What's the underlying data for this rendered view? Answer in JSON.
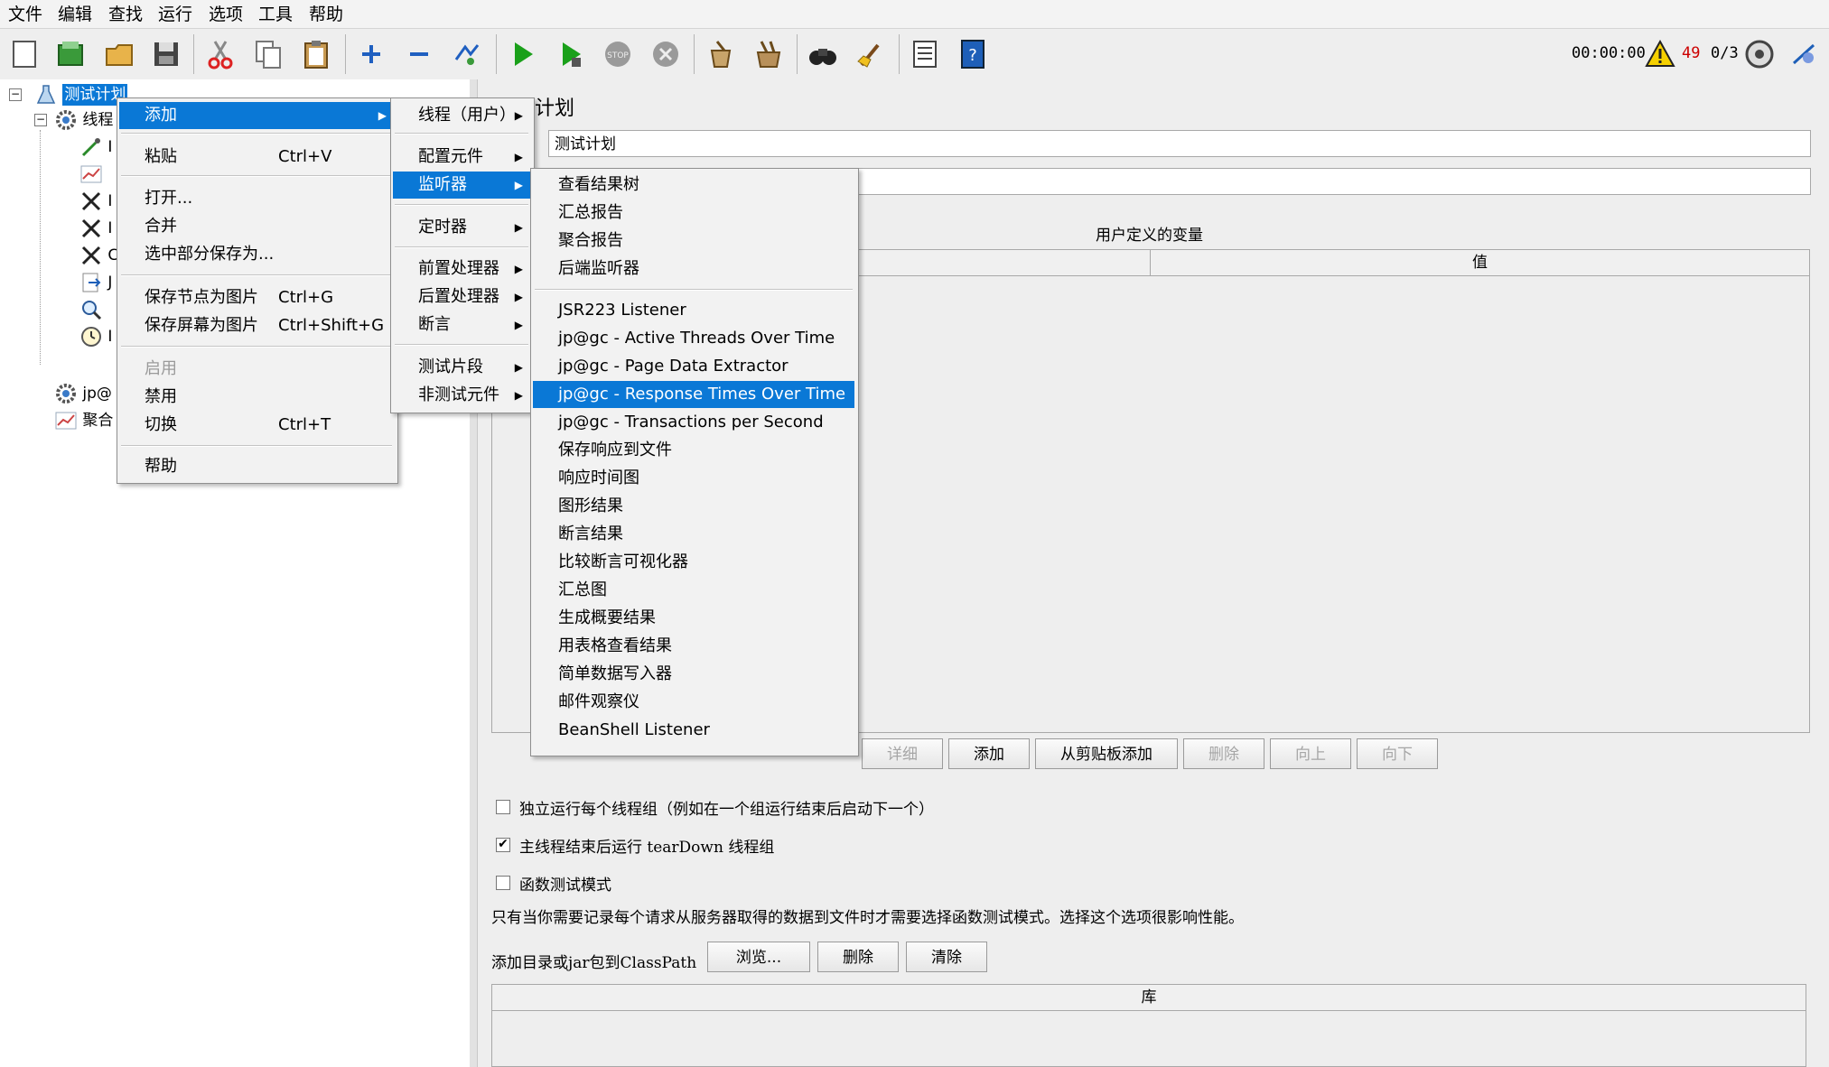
{
  "menubar": [
    "文件",
    "编辑",
    "查找",
    "运行",
    "选项",
    "工具",
    "帮助"
  ],
  "status": {
    "time": "00:00:00",
    "warning_count": "49",
    "threads": "0/3"
  },
  "colors": {
    "selection": "#0a78d6",
    "warning": "#cc0000"
  },
  "toolbar_icons": [
    "new-icon",
    "templates-icon",
    "open-icon",
    "save-icon",
    "cut-icon",
    "copy-icon",
    "paste-icon",
    "expand-icon",
    "collapse-icon",
    "toggle-icon",
    "start-icon",
    "start-no-pause-icon",
    "stop-icon",
    "shutdown-icon",
    "clear-icon",
    "clear-all-icon",
    "search-icon",
    "reset-search-icon",
    "function-helper-icon",
    "help-icon"
  ],
  "tree": {
    "root": "测试计划",
    "thread_group": "线程",
    "child_prefixes": [
      "I",
      "",
      "I",
      "I",
      "C",
      "J",
      "",
      "I"
    ],
    "jpgc_node": "jp@",
    "aggregate_node": "聚合"
  },
  "context_menu": {
    "items": [
      {
        "label": "添加",
        "submenu": true,
        "selected": true
      },
      {
        "label": "粘贴",
        "acc": "Ctrl+V"
      },
      {
        "label": "打开..."
      },
      {
        "label": "合并"
      },
      {
        "label": "选中部分保存为..."
      },
      {
        "label": "保存节点为图片",
        "acc": "Ctrl+G"
      },
      {
        "label": "保存屏幕为图片",
        "acc": "Ctrl+Shift+G"
      },
      {
        "label": "启用",
        "disabled": true
      },
      {
        "label": "禁用"
      },
      {
        "label": "切换",
        "acc": "Ctrl+T"
      },
      {
        "label": "帮助"
      }
    ]
  },
  "add_menu": {
    "items": [
      "线程（用户）",
      "配置元件",
      "监听器",
      "定时器",
      "前置处理器",
      "后置处理器",
      "断言",
      "测试片段",
      "非测试元件"
    ]
  },
  "listener_menu": {
    "items": [
      "查看结果树",
      "汇总报告",
      "聚合报告",
      "后端监听器",
      "JSR223 Listener",
      "jp@gc - Active Threads Over Time",
      "jp@gc - Page Data Extractor",
      "jp@gc - Response Times Over Time",
      "jp@gc - Transactions per Second",
      "保存响应到文件",
      "响应时间图",
      "图形结果",
      "断言结果",
      "比较断言可视化器",
      "汇总图",
      "生成概要结果",
      "用表格查看结果",
      "简单数据写入器",
      "邮件观察仪",
      "BeanShell Listener"
    ]
  },
  "test_plan": {
    "title_partial": "计划",
    "name_value": "测试计划",
    "variables_label": "用户定义的变量",
    "value_header": "值",
    "buttons": {
      "detail": "详细",
      "add": "添加",
      "add_clipboard": "从剪贴板添加",
      "delete": "删除",
      "up": "向上",
      "down": "向下"
    },
    "opt_serial": "独立运行每个线程组（例如在一个组运行结束后启动下一个）",
    "opt_teardown": "主线程结束后运行 tearDown 线程组",
    "opt_functional": "函数测试模式",
    "functional_note": "只有当你需要记录每个请求从服务器取得的数据到文件时才需要选择函数测试模式。选择这个选项很影响性能。",
    "classpath_label": "添加目录或jar包到ClassPath",
    "browse": "浏览...",
    "cp_delete": "删除",
    "cp_clear": "清除",
    "library_header": "库"
  }
}
